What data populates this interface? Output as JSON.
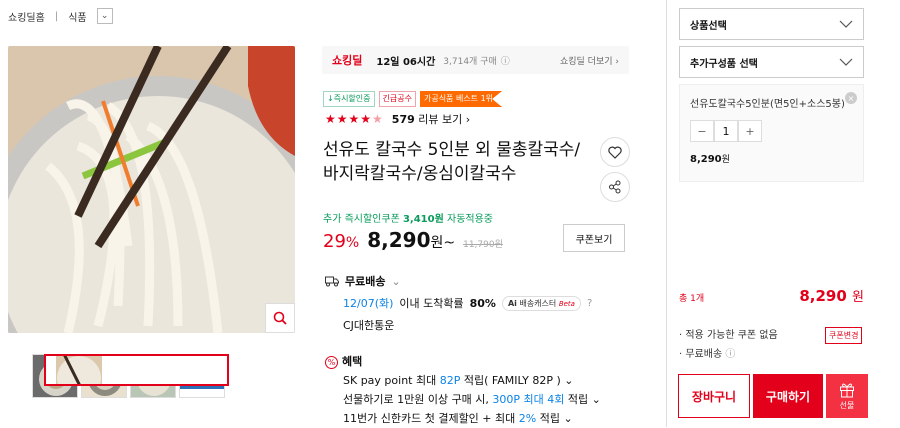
{
  "breadcrumb": {
    "home": "쇼킹딜홈",
    "category": "식품"
  },
  "promo": {
    "logo": "쇼킹딜",
    "time": "12일 06시간",
    "count": "3,714개 구매",
    "more": "쇼킹딜 더보기"
  },
  "badges": [
    "↓즉시할인중",
    "긴급공수",
    "가공식품 베스트 1위"
  ],
  "rating": {
    "stars": 4.5,
    "reviews": "579",
    "review_label": "리뷰 보기"
  },
  "product": {
    "title": "선유도 칼국수 5인분 외 물총칼국수/바지락칼국수/옹심이칼국수",
    "coupon_prefix": "추가 즉시할인쿠폰",
    "coupon_amount": "3,410원",
    "coupon_suffix": "자동적용중",
    "discount_rate": "29",
    "discount_unit": "%",
    "price": "8,290",
    "price_unit": "원~",
    "original_price": "11,790원",
    "coupon_button": "쿠폰보기"
  },
  "shipping": {
    "label": "무료배송",
    "date": "12/07(화)",
    "rate_text": "이내 도착확률",
    "rate": "80%",
    "ai_prefix": "Ai",
    "ai_label": "배송캐스터",
    "ai_beta": "Beta",
    "carrier": "CJ대한통운"
  },
  "benefits": {
    "label": "혜택",
    "line1_a": "SK pay point 최대",
    "line1_b": "82P",
    "line1_c": "적립( FAMILY 82P )",
    "line2_a": "선물하기로 1만원 이상 구매 시,",
    "line2_b": "300P 최대 4회",
    "line2_c": "적립",
    "line3_a": "11번가 신한카드 첫 결제할인 + 최대",
    "line3_b": "2%",
    "line3_c": "적립"
  },
  "sidebar": {
    "product_select": "상품선택",
    "addon_select": "추가구성품 선택",
    "item_name": "선유도칼국수5인분(면5인+소스5봉)",
    "item_qty": "1",
    "item_price": "8,290",
    "item_price_unit": "원",
    "total_label": "총 1개",
    "total_amount": "8,290",
    "total_unit": "원",
    "coupon_info": "적용 가능한 쿠폰 없음",
    "coupon_change": "쿠폰변경",
    "shipping_info": "무료배송",
    "cart": "장바구니",
    "buy": "구매하기",
    "gift": "선물"
  },
  "colors": {
    "accent": "#e2001a",
    "link_blue": "#0b83e6",
    "green": "#0a9b5b",
    "orange": "#ff6a00"
  }
}
